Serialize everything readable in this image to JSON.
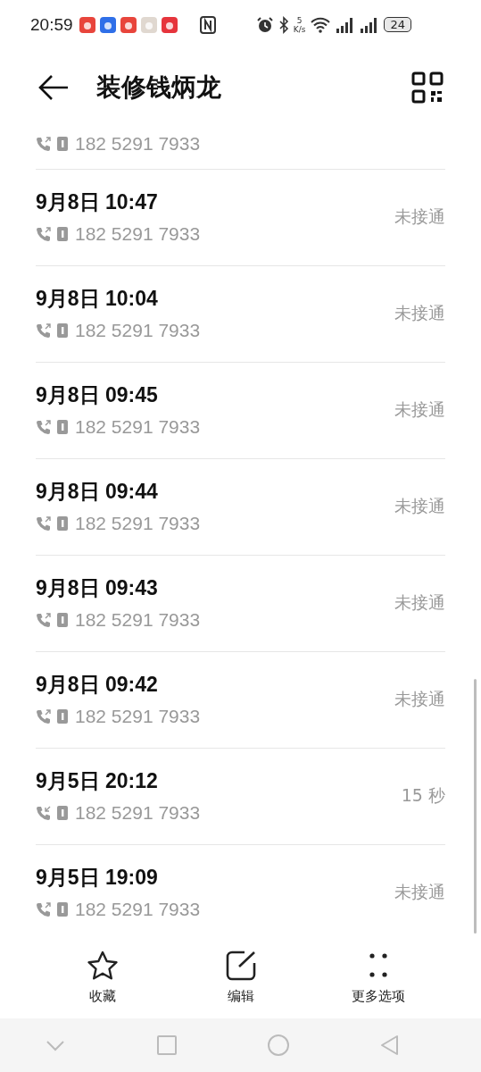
{
  "status_bar": {
    "time": "20:59",
    "notifications": [
      {
        "color": "#e8453c"
      },
      {
        "color": "#2f6fe8"
      },
      {
        "color": "#e8453c"
      },
      {
        "color": "#e0d8d0"
      },
      {
        "color": "#e6343c"
      }
    ],
    "speed_value": "5",
    "speed_unit": "K/s",
    "battery": "24"
  },
  "header": {
    "title": "装修钱炳龙"
  },
  "calls": [
    {
      "kind": "outgoing",
      "number": "182 5291 7933"
    },
    {
      "kind": "outgoing",
      "date": "9月8日 10:47",
      "number": "182 5291 7933",
      "status": "未接通"
    },
    {
      "kind": "outgoing",
      "date": "9月8日 10:04",
      "number": "182 5291 7933",
      "status": "未接通"
    },
    {
      "kind": "outgoing",
      "date": "9月8日 09:45",
      "number": "182 5291 7933",
      "status": "未接通"
    },
    {
      "kind": "outgoing",
      "date": "9月8日 09:44",
      "number": "182 5291 7933",
      "status": "未接通"
    },
    {
      "kind": "outgoing",
      "date": "9月8日 09:43",
      "number": "182 5291 7933",
      "status": "未接通"
    },
    {
      "kind": "outgoing",
      "date": "9月8日 09:42",
      "number": "182 5291 7933",
      "status": "未接通"
    },
    {
      "kind": "incoming",
      "date": "9月5日 20:12",
      "number": "182 5291 7933",
      "status": "15 秒"
    },
    {
      "kind": "outgoing",
      "date": "9月5日 19:09",
      "number": "182 5291 7933",
      "status": "未接通"
    }
  ],
  "actions": [
    {
      "kind": "star",
      "label": "收藏"
    },
    {
      "kind": "edit",
      "label": "编辑"
    },
    {
      "kind": "more",
      "label": "更多选项"
    }
  ]
}
